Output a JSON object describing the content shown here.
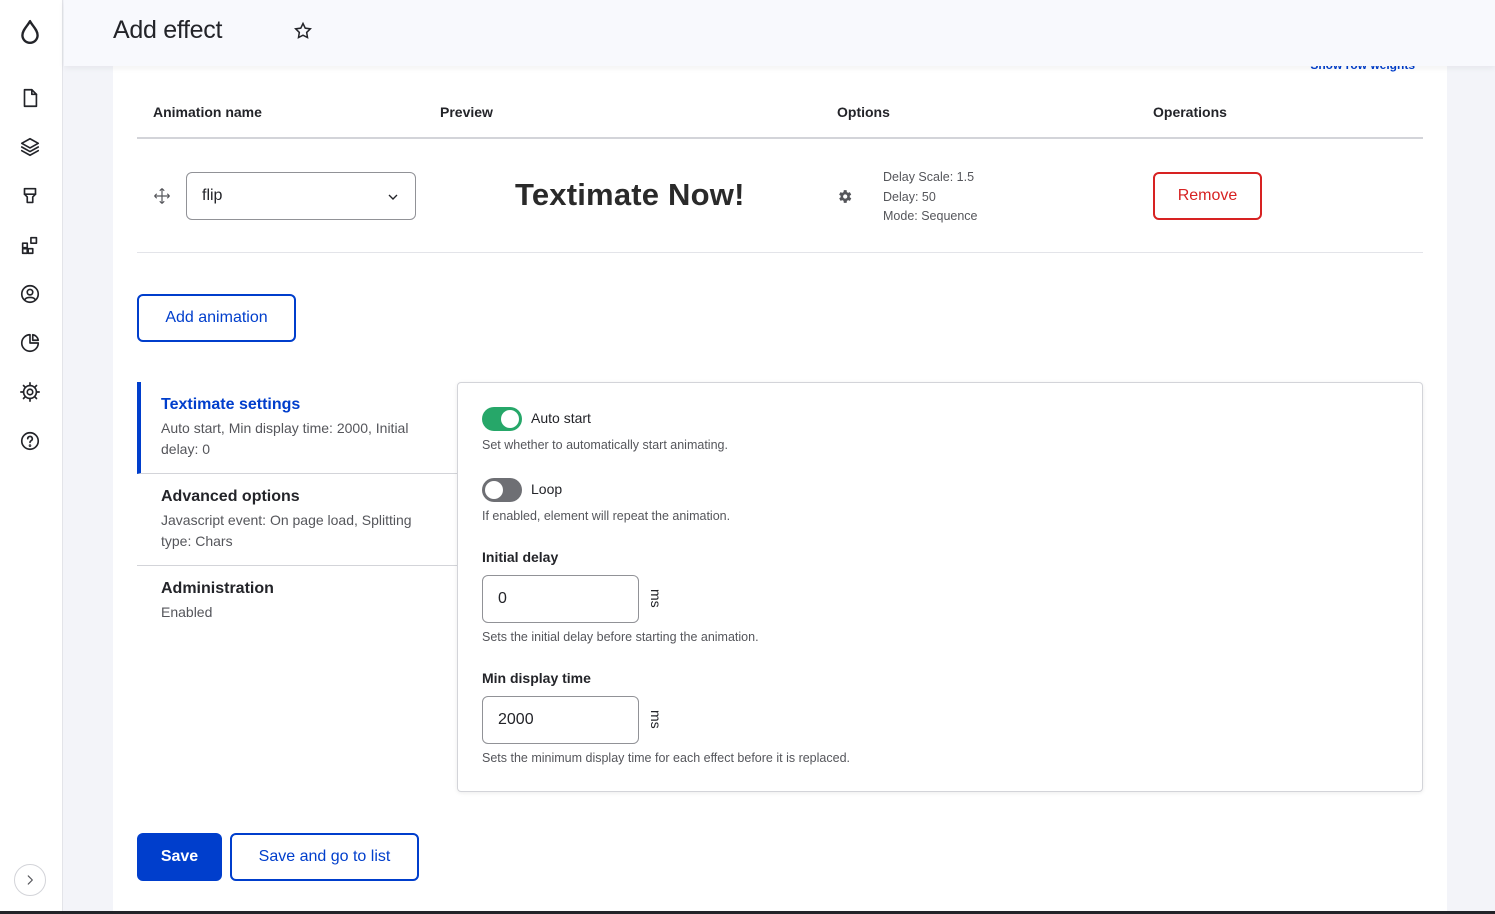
{
  "header": {
    "title": "Add effect"
  },
  "table": {
    "show_row_weights": "Show row weights",
    "columns": [
      "Animation name",
      "Preview",
      "Options",
      "Operations"
    ],
    "row": {
      "animation": "flip",
      "preview": "Textimate Now!",
      "options": [
        "Delay Scale: 1.5",
        "Delay: 50",
        "Mode: Sequence"
      ],
      "remove_label": "Remove"
    }
  },
  "add_animation_label": "Add animation",
  "vtabs": [
    {
      "title": "Textimate settings",
      "summary": "Auto start, Min display time: 2000, Initial delay: 0"
    },
    {
      "title": "Advanced options",
      "summary": "Javascript event: On page load, Splitting type: Chars"
    },
    {
      "title": "Administration",
      "summary": "Enabled"
    }
  ],
  "settings": {
    "auto_start": {
      "label": "Auto start",
      "description": "Set whether to automatically start animating.",
      "enabled": true
    },
    "loop": {
      "label": "Loop",
      "description": "If enabled, element will repeat the animation.",
      "enabled": false
    },
    "initial_delay": {
      "label": "Initial delay",
      "value": "0",
      "suffix": "ms",
      "description": "Sets the initial delay before starting the animation."
    },
    "min_display_time": {
      "label": "Min display time",
      "value": "2000",
      "suffix": "ms",
      "description": "Sets the minimum display time for each effect before it is replaced."
    }
  },
  "actions": {
    "save": "Save",
    "save_list": "Save and go to list"
  },
  "colors": {
    "primary": "#003ecc",
    "danger": "#d72222",
    "toggle_on": "#26a769"
  }
}
